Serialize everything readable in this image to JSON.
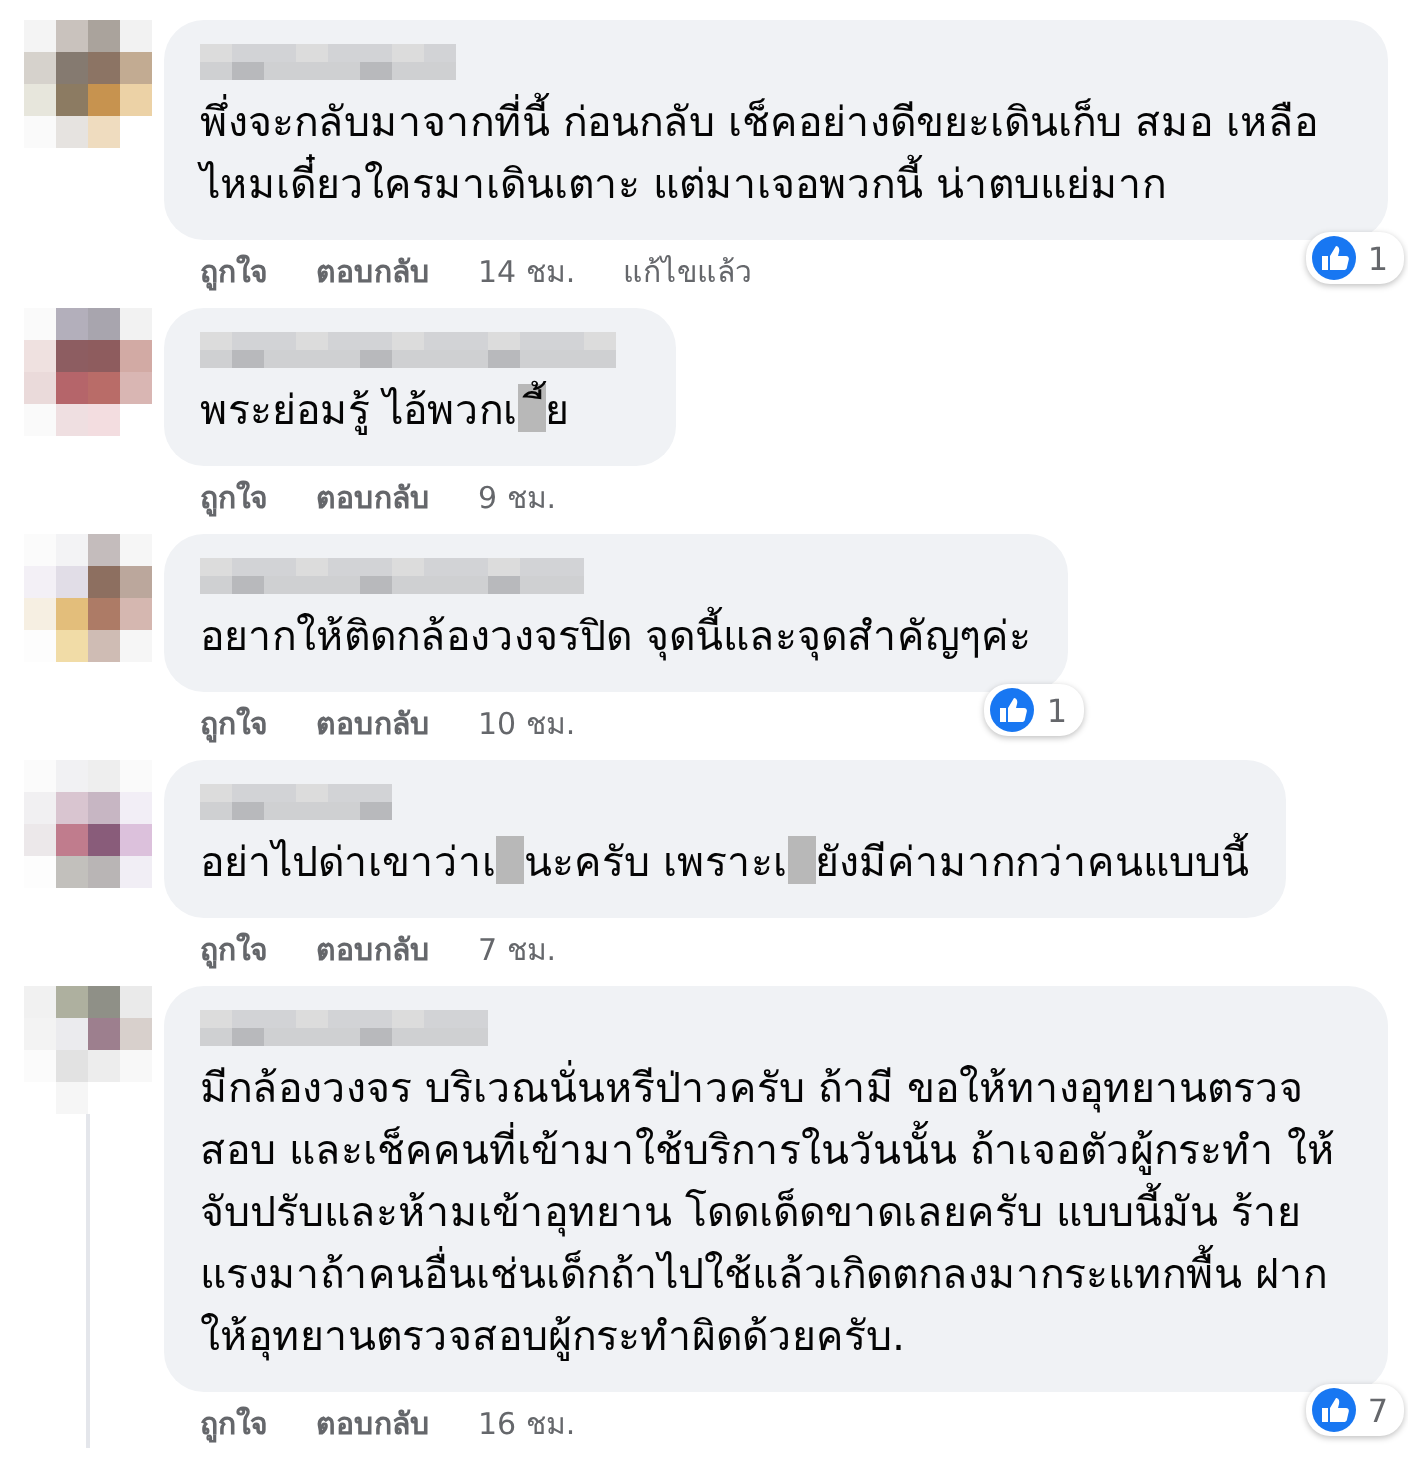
{
  "comments": [
    {
      "text_parts": [
        "พึ่งจะกลับมาจากที่นี้ ก่อนกลับ เช็คอย่างดีขยะเดินเก็บ สมอ เหลือไหมเดี๋ยวใครมาเดินเตาะ แต่มาเจอพวกนี้ น่าตบแย่มาก"
      ],
      "like": "ถูกใจ",
      "reply": "ตอบกลับ",
      "time": "14 ชม.",
      "edited": "แก้ไขแล้ว",
      "reactions": "1",
      "thread_line": false
    },
    {
      "text_parts": [
        "พระย่อมรู้ ไอ้พวกเ",
        "ี้ย"
      ],
      "like": "ถูกใจ",
      "reply": "ตอบกลับ",
      "time": "9 ชม.",
      "thread_line": false
    },
    {
      "text_parts": [
        "อยากให้ติดกล้องวงจรปิด จุดนี้และจุดสำคัญๆค่ะ"
      ],
      "like": "ถูกใจ",
      "reply": "ตอบกลับ",
      "time": "10 ชม.",
      "reactions": "1",
      "thread_line": false
    },
    {
      "text_parts": [
        "อย่าไปด่าเขาว่าเ",
        "นะครับ เพราะเ",
        "ยังมีค่ามากกว่าคนแบบนี้"
      ],
      "like": "ถูกใจ",
      "reply": "ตอบกลับ",
      "time": "7 ชม.",
      "thread_line": false
    },
    {
      "text_parts": [
        "มีกล้องวงจร บริเวณนั่นหรีป่าวครับ ถ้ามี ขอให้ทางอุทยานตรวจ สอบ และเช็คคนที่เข้ามาใช้บริการในวันนั้น ถ้าเจอตัวผู้กระทำ ให้จับปรับและห้ามเข้าอุทยาน โดดเด็ดขาดเลยครับ แบบนี้มัน ร้ายแรงมาถ้าคนอื่นเช่นเด็กถ้าไปใช้แล้วเกิดตกลงมากระแทกพื้น ฝากให้อุทยานตรวจสอบผู้กระทำผิดด้วยครับ."
      ],
      "like": "ถูกใจ",
      "reply": "ตอบกลับ",
      "time": "16 ชม.",
      "reactions": "7",
      "thread_line": true
    }
  ]
}
